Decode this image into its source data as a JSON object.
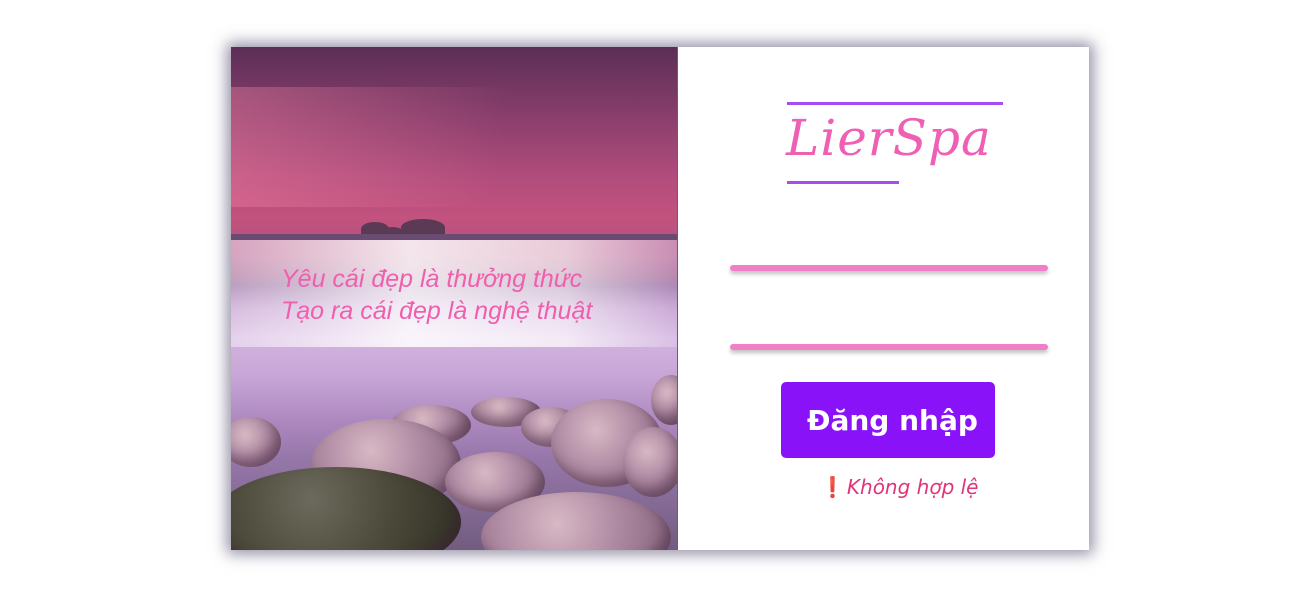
{
  "hero": {
    "quote_line1": "Yêu cái đẹp là thưởng thức",
    "quote_line2": "Tạo ra cái đẹp là nghệ thuật"
  },
  "brand": {
    "logo": "LierSpa"
  },
  "form": {
    "username_placeholder": "",
    "password_placeholder": "",
    "login_label": "Đăng nhập",
    "error_icon": "❗",
    "error_text": "Không hợp lệ"
  },
  "colors": {
    "accent_purple": "#8a12f8",
    "brand_pink": "#ef5fb4",
    "field_pink": "#f07fc8",
    "error_red": "#e0347a"
  }
}
